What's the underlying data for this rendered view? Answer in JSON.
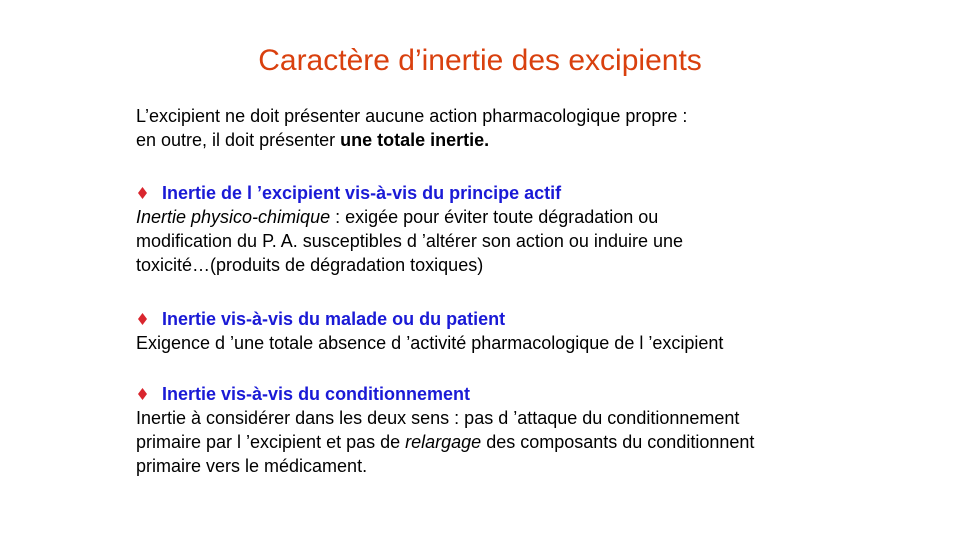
{
  "title": "Caractère d’inertie des excipients",
  "intro": {
    "line1": "L’excipient  ne doit présenter aucune  action  pharmacologique  propre :",
    "line2_before": "en outre, il doit présenter ",
    "line2_bold": "une totale inertie."
  },
  "sections": [
    {
      "heading": "Inertie de l ’excipient vis-à-vis du principe actif",
      "line1_italic": "Inertie physico-chimique",
      "line1_rest": " : exigée pour éviter toute dégradation ou",
      "line2": "modification du P. A. susceptibles d ’altérer son action ou induire une",
      "line3": "toxicité…(produits de dégradation toxiques)"
    },
    {
      "heading": "Inertie vis-à-vis du malade ou du patient",
      "line1": "Exigence  d ’une  totale absence d ’activité pharmacologique  de l ’excipient"
    },
    {
      "heading": "Inertie vis-à-vis du conditionnement",
      "line1": "Inertie à considérer dans les deux sens : pas d ’attaque du conditionnement",
      "line2_before": "primaire par l ’excipient  et pas de ",
      "line2_italic": "relargage",
      "line2_after": " des composants du conditionnent",
      "line3": "primaire vers le médicament."
    }
  ],
  "colors": {
    "title": "#d9400e",
    "heading": "#1a1ad6",
    "bullet": "#d9262e"
  },
  "bullet_icon": "diamond-icon"
}
